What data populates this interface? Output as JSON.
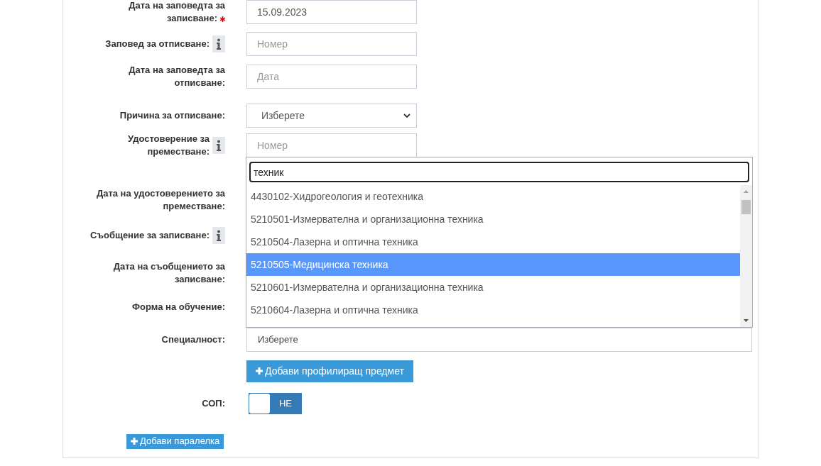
{
  "fields": [
    {
      "label": "Дата на заповедта за записване:",
      "required": true,
      "info": false,
      "kind": "input",
      "value": "15.09.2023"
    },
    {
      "label": "Заповед за отписване:",
      "required": false,
      "info": true,
      "kind": "input",
      "placeholder": "Номер"
    },
    {
      "label": "Дата на заповедта за отписване:",
      "required": false,
      "info": false,
      "kind": "input",
      "placeholder": "Дата"
    },
    {
      "label": "Причина за отписване:",
      "required": false,
      "info": false,
      "kind": "select",
      "value": "Изберете"
    },
    {
      "label": "Удостоверение за преместване:",
      "required": false,
      "info": true,
      "kind": "input",
      "placeholder": "Номер"
    },
    {
      "label": "Дата на удостоверението за преместване:",
      "required": false,
      "info": false,
      "kind": "covered"
    },
    {
      "label": "Съобщение за записване:",
      "required": false,
      "info": true,
      "kind": "covered"
    },
    {
      "label": "Дата на съобщението за записване:",
      "required": false,
      "info": false,
      "kind": "covered"
    },
    {
      "label": "Форма на обучение:",
      "required": false,
      "info": false,
      "kind": "covered"
    },
    {
      "label": "Специалност:",
      "required": false,
      "info": false,
      "kind": "combo",
      "value": "Изберете",
      "dropdown": {
        "search_value": "техник",
        "options": [
          {
            "text": "4430102-Хидрогеология и геотехника",
            "selected": false
          },
          {
            "text": "5210501-Измервателна и организационна техника",
            "selected": false
          },
          {
            "text": "5210504-Лазерна и оптична техника",
            "selected": false
          },
          {
            "text": "5210505-Медицинска техника",
            "selected": true
          },
          {
            "text": "5210601-Измервателна и организационна техника",
            "selected": false
          },
          {
            "text": "5210604-Лазерна и оптична техника",
            "selected": false
          }
        ]
      }
    }
  ],
  "add_subject_button": "Добави профилиращ предмет",
  "sop": {
    "label": "СОП:",
    "on": false,
    "text": "НЕ"
  },
  "add_class_button": "Добави паралелка"
}
